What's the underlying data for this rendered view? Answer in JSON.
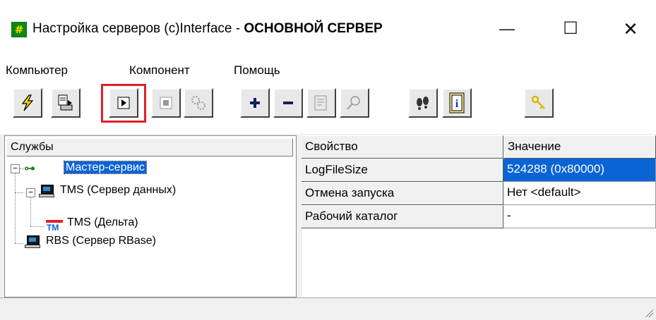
{
  "window": {
    "title_prefix": "Настройка серверов (c)Interface - ",
    "title_bold": "ОСНОВНОЙ СЕРВЕР",
    "minimize": "—",
    "maximize": "☐",
    "close": "✕"
  },
  "menu": [
    "Компьютер",
    "Компонент",
    "Помощь"
  ],
  "toolbar": [
    {
      "name": "connect-button",
      "icon": "lightning-icon",
      "glyph": "⚡",
      "enabled": true
    },
    {
      "name": "export-button",
      "icon": "document-arrow-icon",
      "glyph": "⎘",
      "enabled": true
    },
    {
      "name": "start-button",
      "icon": "play-icon",
      "glyph": "▶",
      "enabled": true,
      "highlighted": true
    },
    {
      "name": "stop-button",
      "icon": "stop-icon",
      "glyph": "■",
      "enabled": false
    },
    {
      "name": "services-button",
      "icon": "gears-icon",
      "glyph": "⚙",
      "enabled": false
    },
    {
      "name": "add-button",
      "icon": "plus-icon",
      "glyph": "+",
      "enabled": true
    },
    {
      "name": "remove-button",
      "icon": "minus-icon",
      "glyph": "−",
      "enabled": true
    },
    {
      "name": "properties-button",
      "icon": "properties-icon",
      "glyph": "☰",
      "enabled": false
    },
    {
      "name": "find-button",
      "icon": "search-icon",
      "glyph": "⌕",
      "enabled": false
    },
    {
      "name": "trace-button",
      "icon": "footprints-icon",
      "glyph": "👣",
      "enabled": true
    },
    {
      "name": "info-button",
      "icon": "info-icon",
      "glyph": "ℹ",
      "enabled": true
    },
    {
      "name": "key-button",
      "icon": "key-icon",
      "glyph": "🔑",
      "enabled": true
    }
  ],
  "services_panel": {
    "header": "Службы",
    "tree": [
      {
        "label": "Мастер-сервис",
        "level": 0,
        "selected": true,
        "expanded": true,
        "icon": "network-icon"
      },
      {
        "label": "TMS (Сервер данных)",
        "level": 1,
        "selected": false,
        "expanded": true,
        "icon": "computer-icon"
      },
      {
        "label": "TMS (Дельта)",
        "level": 2,
        "selected": false,
        "icon": "tm-icon"
      },
      {
        "label": "RBS (Сервер RBase)",
        "level": 1,
        "selected": false,
        "icon": "computer-icon"
      }
    ]
  },
  "properties_panel": {
    "columns": [
      "Свойство",
      "Значение"
    ],
    "rows": [
      {
        "property": "LogFileSize",
        "value": "524288 (0x80000)",
        "selected": true
      },
      {
        "property": "Отмена запуска",
        "value": "Нет <default>",
        "selected": false
      },
      {
        "property": "Рабочий каталог",
        "value": "-",
        "selected": false
      }
    ]
  },
  "colors": {
    "selection": "#0a64d6",
    "highlight_frame": "#e0202a",
    "app_icon": "#0a8a0a"
  }
}
